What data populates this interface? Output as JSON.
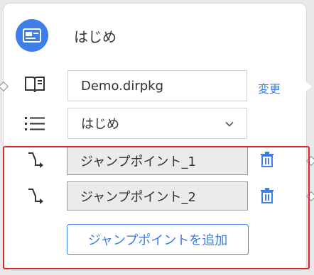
{
  "node": {
    "title": "はじめ",
    "header_icon": "id-card-icon"
  },
  "package_row": {
    "icon": "book-icon",
    "value": "Demo.dirpkg",
    "change_label": "変更"
  },
  "entry_row": {
    "icon": "list-icon",
    "selected": "はじめ",
    "dropdown_icon": "chevron-down-icon"
  },
  "jump_points": [
    {
      "label": "ジャンプポイント_1",
      "icon": "branch-icon",
      "delete_icon": "trash-icon"
    },
    {
      "label": "ジャンプポイント_2",
      "icon": "branch-icon",
      "delete_icon": "trash-icon"
    }
  ],
  "add_button_label": "ジャンプポイントを追加",
  "colors": {
    "accent": "#3d7fe6",
    "highlight": "#d9262c"
  }
}
